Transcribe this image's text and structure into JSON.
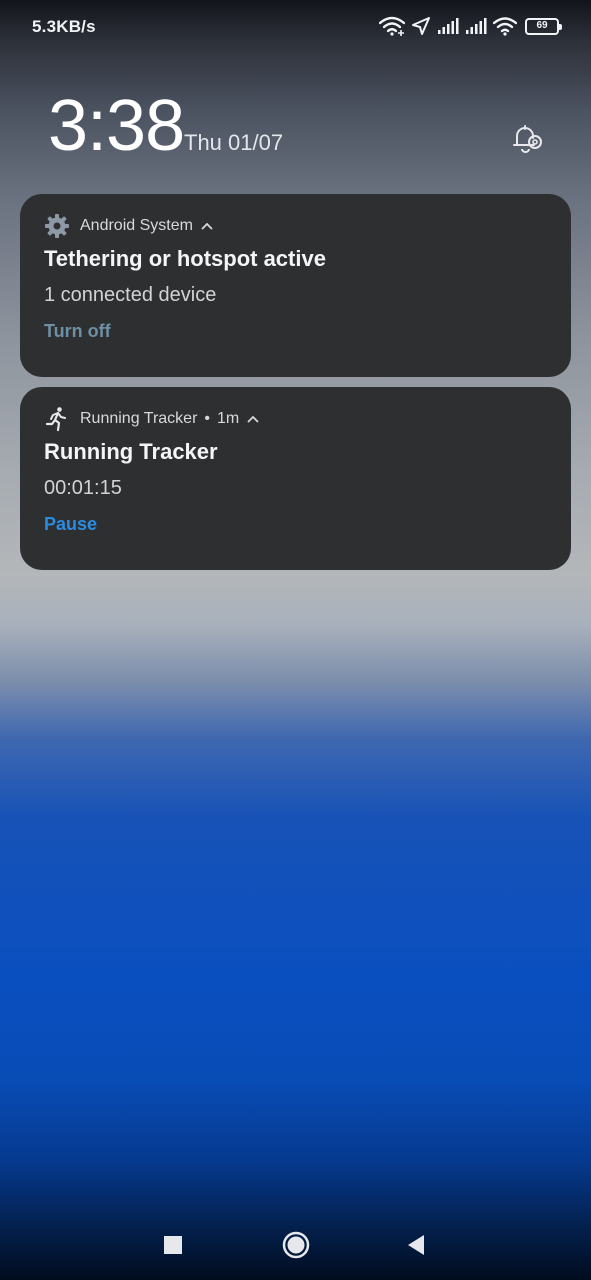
{
  "status_bar": {
    "net_speed": "5.3KB/s",
    "battery_level": "69",
    "icons": [
      "wifi-hotspot-icon",
      "location-icon",
      "signal-icon",
      "signal-icon",
      "wifi-icon",
      "battery-icon"
    ]
  },
  "lockscreen": {
    "time": "3:38",
    "date": "Thu 01/07"
  },
  "notifications": [
    {
      "app": "Android System",
      "icon": "gear-icon",
      "title": "Tethering or hotspot active",
      "text": "1 connected device",
      "action": "Turn off",
      "action_color": "#6f8fa3"
    },
    {
      "app": "Running Tracker",
      "icon": "runner-icon",
      "time_ago": "1m",
      "title": "Running Tracker",
      "text": "00:01:15",
      "action": "Pause",
      "action_color": "#2a8be0"
    }
  ],
  "nav": [
    "recents-icon",
    "home-icon",
    "back-icon"
  ]
}
